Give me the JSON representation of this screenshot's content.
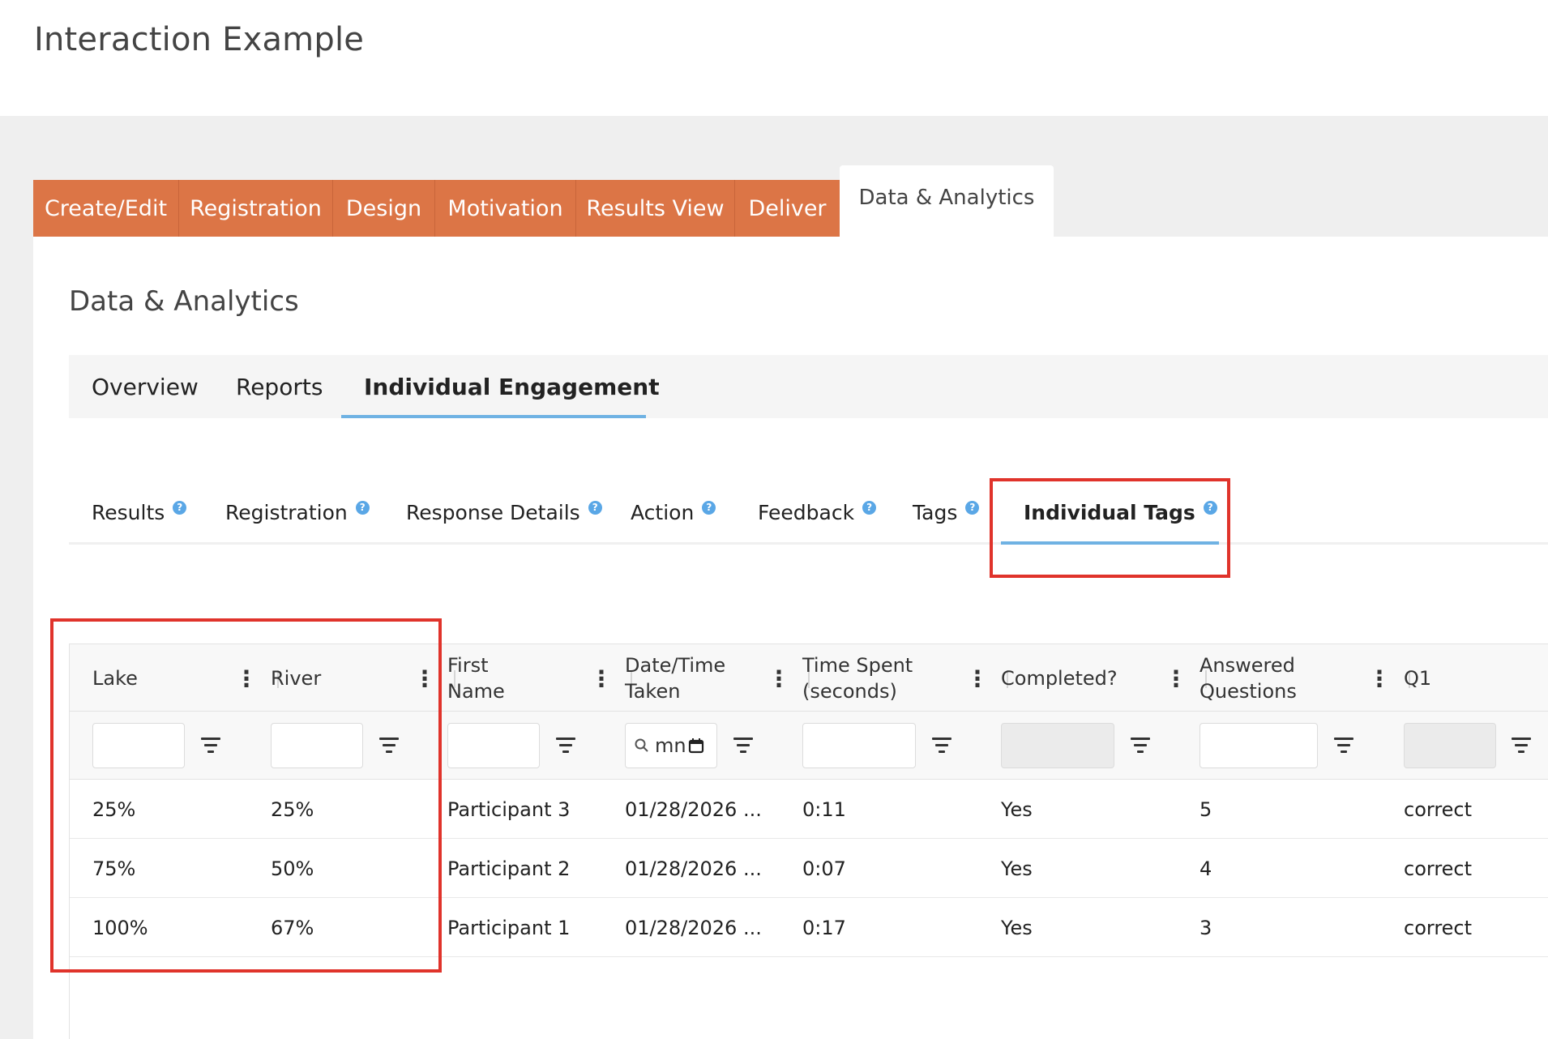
{
  "app": {
    "title": "Interaction Example"
  },
  "top_tabs": [
    {
      "label": "Create/Edit"
    },
    {
      "label": "Registration"
    },
    {
      "label": "Design"
    },
    {
      "label": "Motivation"
    },
    {
      "label": "Results View"
    },
    {
      "label": "Deliver"
    },
    {
      "label": "Data & Analytics",
      "active": true
    }
  ],
  "section": {
    "title": "Data & Analytics"
  },
  "sub_tabs": [
    {
      "label": "Overview"
    },
    {
      "label": "Reports"
    },
    {
      "label": "Individual Engagement",
      "active": true
    }
  ],
  "data_tabs": [
    {
      "label": "Results",
      "help": "?"
    },
    {
      "label": "Registration",
      "help": "?"
    },
    {
      "label": "Response Details",
      "help": "?"
    },
    {
      "label": "Action",
      "help": "?"
    },
    {
      "label": "Feedback",
      "help": "?"
    },
    {
      "label": "Tags",
      "help": "?"
    },
    {
      "label": "Individual Tags",
      "help": "?",
      "active": true
    }
  ],
  "table": {
    "columns": [
      {
        "line1": "Lake",
        "line2": ""
      },
      {
        "line1": "River",
        "line2": ""
      },
      {
        "line1": "First",
        "line2": "Name"
      },
      {
        "line1": "Date/Time",
        "line2": "Taken"
      },
      {
        "line1": "Time Spent",
        "line2": "(seconds)"
      },
      {
        "line1": "Completed?",
        "line2": ""
      },
      {
        "line1": "Answered",
        "line2": "Questions"
      },
      {
        "line1": "Q1",
        "line2": ""
      }
    ],
    "menu_glyph": "⋮",
    "date_filter_value": "mn",
    "rows": [
      [
        "25%",
        "25%",
        "Participant 3",
        "01/28/2026 ...",
        "0:11",
        "Yes",
        "5",
        "correct"
      ],
      [
        "75%",
        "50%",
        "Participant 2",
        "01/28/2026 ...",
        "0:07",
        "Yes",
        "4",
        "correct"
      ],
      [
        "100%",
        "67%",
        "Participant 1",
        "01/28/2026 ...",
        "0:17",
        "Yes",
        "3",
        "correct"
      ]
    ]
  },
  "colors": {
    "tab_orange": "#dc7546",
    "accent_blue": "#6fb2e3",
    "annotation_red": "#e0332b"
  }
}
